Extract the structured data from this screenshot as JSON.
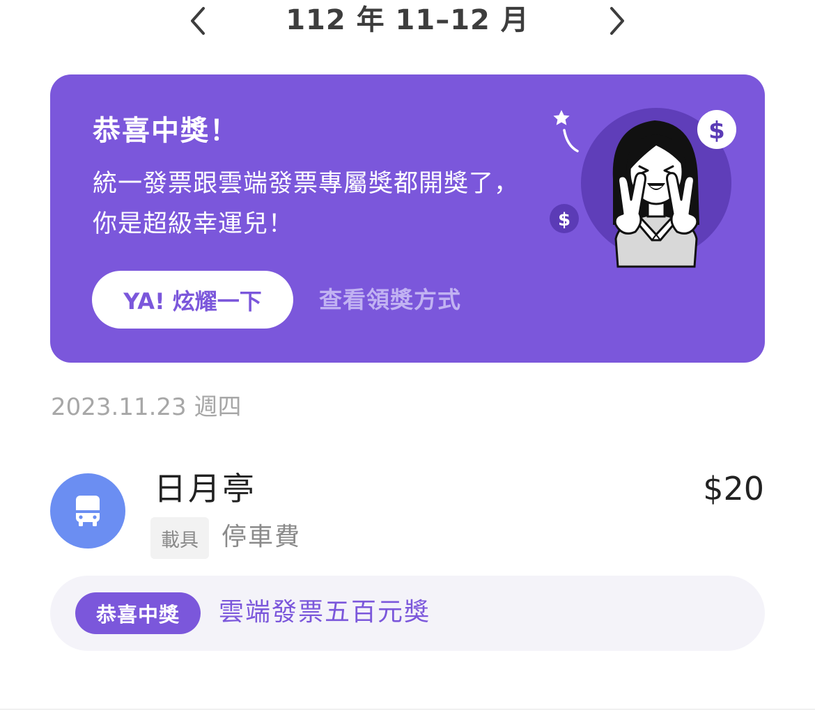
{
  "header": {
    "period": "112 年 11–12 月",
    "prev_icon": "chevron-left-icon",
    "next_icon": "chevron-right-icon"
  },
  "banner": {
    "title": "恭喜中獎！",
    "description": "統一發票跟雲端發票專屬獎都開獎了，你是超級幸運兒！",
    "share_button": "YA! 炫耀一下",
    "claim_link": "查看領獎方式",
    "background_color": "#7b57db",
    "illustration": {
      "coin_symbol": "$",
      "icon": "winner-celebration-illustration"
    }
  },
  "transactions": {
    "date": "2023.11.23 週四",
    "items": [
      {
        "icon": "bus-icon",
        "icon_color": "#6b8ef2",
        "merchant": "日月亭",
        "amount": "$20",
        "carrier_tag": "載具",
        "category": "停車費",
        "prize_badge": "恭喜中獎",
        "prize_text": "雲端發票五百元獎"
      }
    ]
  }
}
